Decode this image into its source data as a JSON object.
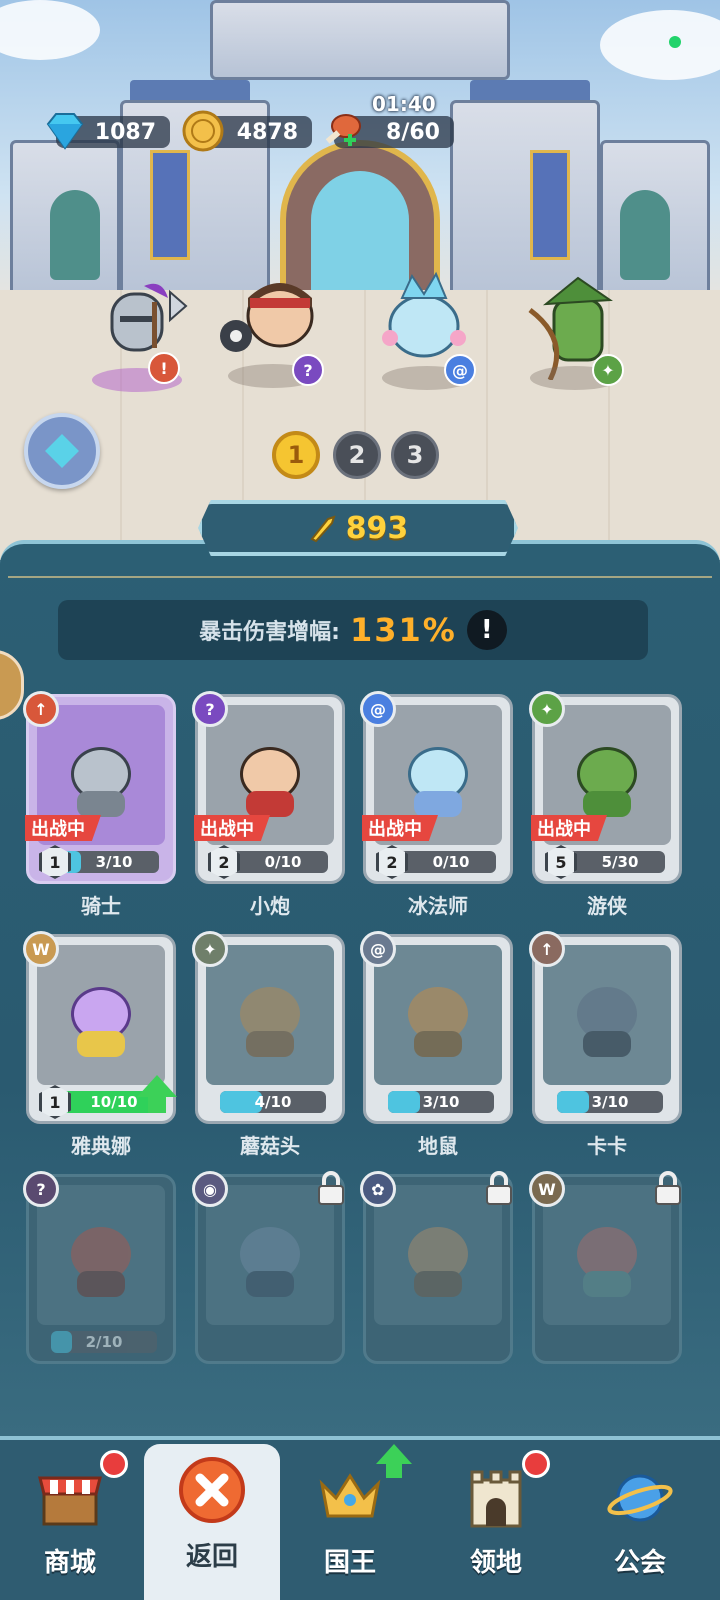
{
  "resources": {
    "diamonds": "1087",
    "gold": "4878",
    "stamina": "8/60",
    "stamina_timer": "01:40"
  },
  "team_tabs": [
    "1",
    "2",
    "3"
  ],
  "team_power": "893",
  "crit_stat": {
    "label": "暴击伤害增幅:",
    "value": "131%",
    "info": "!"
  },
  "heroes": [
    {
      "name": "骑士",
      "level": "1",
      "progress_text": "3/10",
      "progress": 0.3,
      "deployed_label": "出战中",
      "class_icon": "sword-icon",
      "color": "#d9b1a0"
    },
    {
      "name": "小炮",
      "level": "2",
      "progress_text": "0/10",
      "progress": 0.0,
      "deployed_label": "出战中",
      "class_icon": "magic-icon",
      "color": "#f0c9a8"
    },
    {
      "name": "冰法师",
      "level": "2",
      "progress_text": "0/10",
      "progress": 0.0,
      "deployed_label": "出战中",
      "class_icon": "spiral-icon",
      "color": "#bfe7f5"
    },
    {
      "name": "游侠",
      "level": "5",
      "progress_text": "5/30",
      "progress": 0.1667,
      "deployed_label": "出战中",
      "class_icon": "star-icon",
      "color": "#6cab4e"
    },
    {
      "name": "雅典娜",
      "level": "1",
      "progress_text": "10/10",
      "progress": 1.0,
      "upgrade": true,
      "class_icon": "wings-icon",
      "color": "#c9a6f0"
    },
    {
      "name": "蘑菇头",
      "progress_text": "4/10",
      "progress": 0.4,
      "class_icon": "star-icon",
      "color": "#a8885a"
    },
    {
      "name": "地鼠",
      "progress_text": "3/10",
      "progress": 0.3,
      "class_icon": "spiral-icon",
      "color": "#b98a4f"
    },
    {
      "name": "卡卡",
      "progress_text": "3/10",
      "progress": 0.3,
      "class_icon": "sword-icon",
      "color": "#5d7286"
    },
    {
      "name": "",
      "progress_text": "2/10",
      "progress": 0.2,
      "class_icon": "magic-icon",
      "color": "#a8574c"
    },
    {
      "name": "",
      "locked": true,
      "class_icon": "eye-icon",
      "color": "#6d88a0"
    },
    {
      "name": "",
      "locked": true,
      "class_icon": "paw-icon",
      "color": "#a88a68"
    },
    {
      "name": "",
      "locked": true,
      "class_icon": "wings-icon",
      "color": "#a86a68"
    }
  ],
  "nav": [
    {
      "label": "商城",
      "icon": "shop-icon",
      "badge": "red-dot"
    },
    {
      "label": "返回",
      "icon": "close-icon",
      "active": true
    },
    {
      "label": "国王",
      "icon": "crown-icon",
      "badge": "upgrade-arrow"
    },
    {
      "label": "领地",
      "icon": "castle-icon",
      "badge": "red-dot"
    },
    {
      "label": "公会",
      "icon": "planet-icon"
    }
  ],
  "colors": {
    "accent_gold": "#ffd23c",
    "stat_orange": "#ffb02a",
    "deploy_red": "#e6473f",
    "progress_blue": "#4ec4e0",
    "progress_green": "#2fd15a"
  }
}
